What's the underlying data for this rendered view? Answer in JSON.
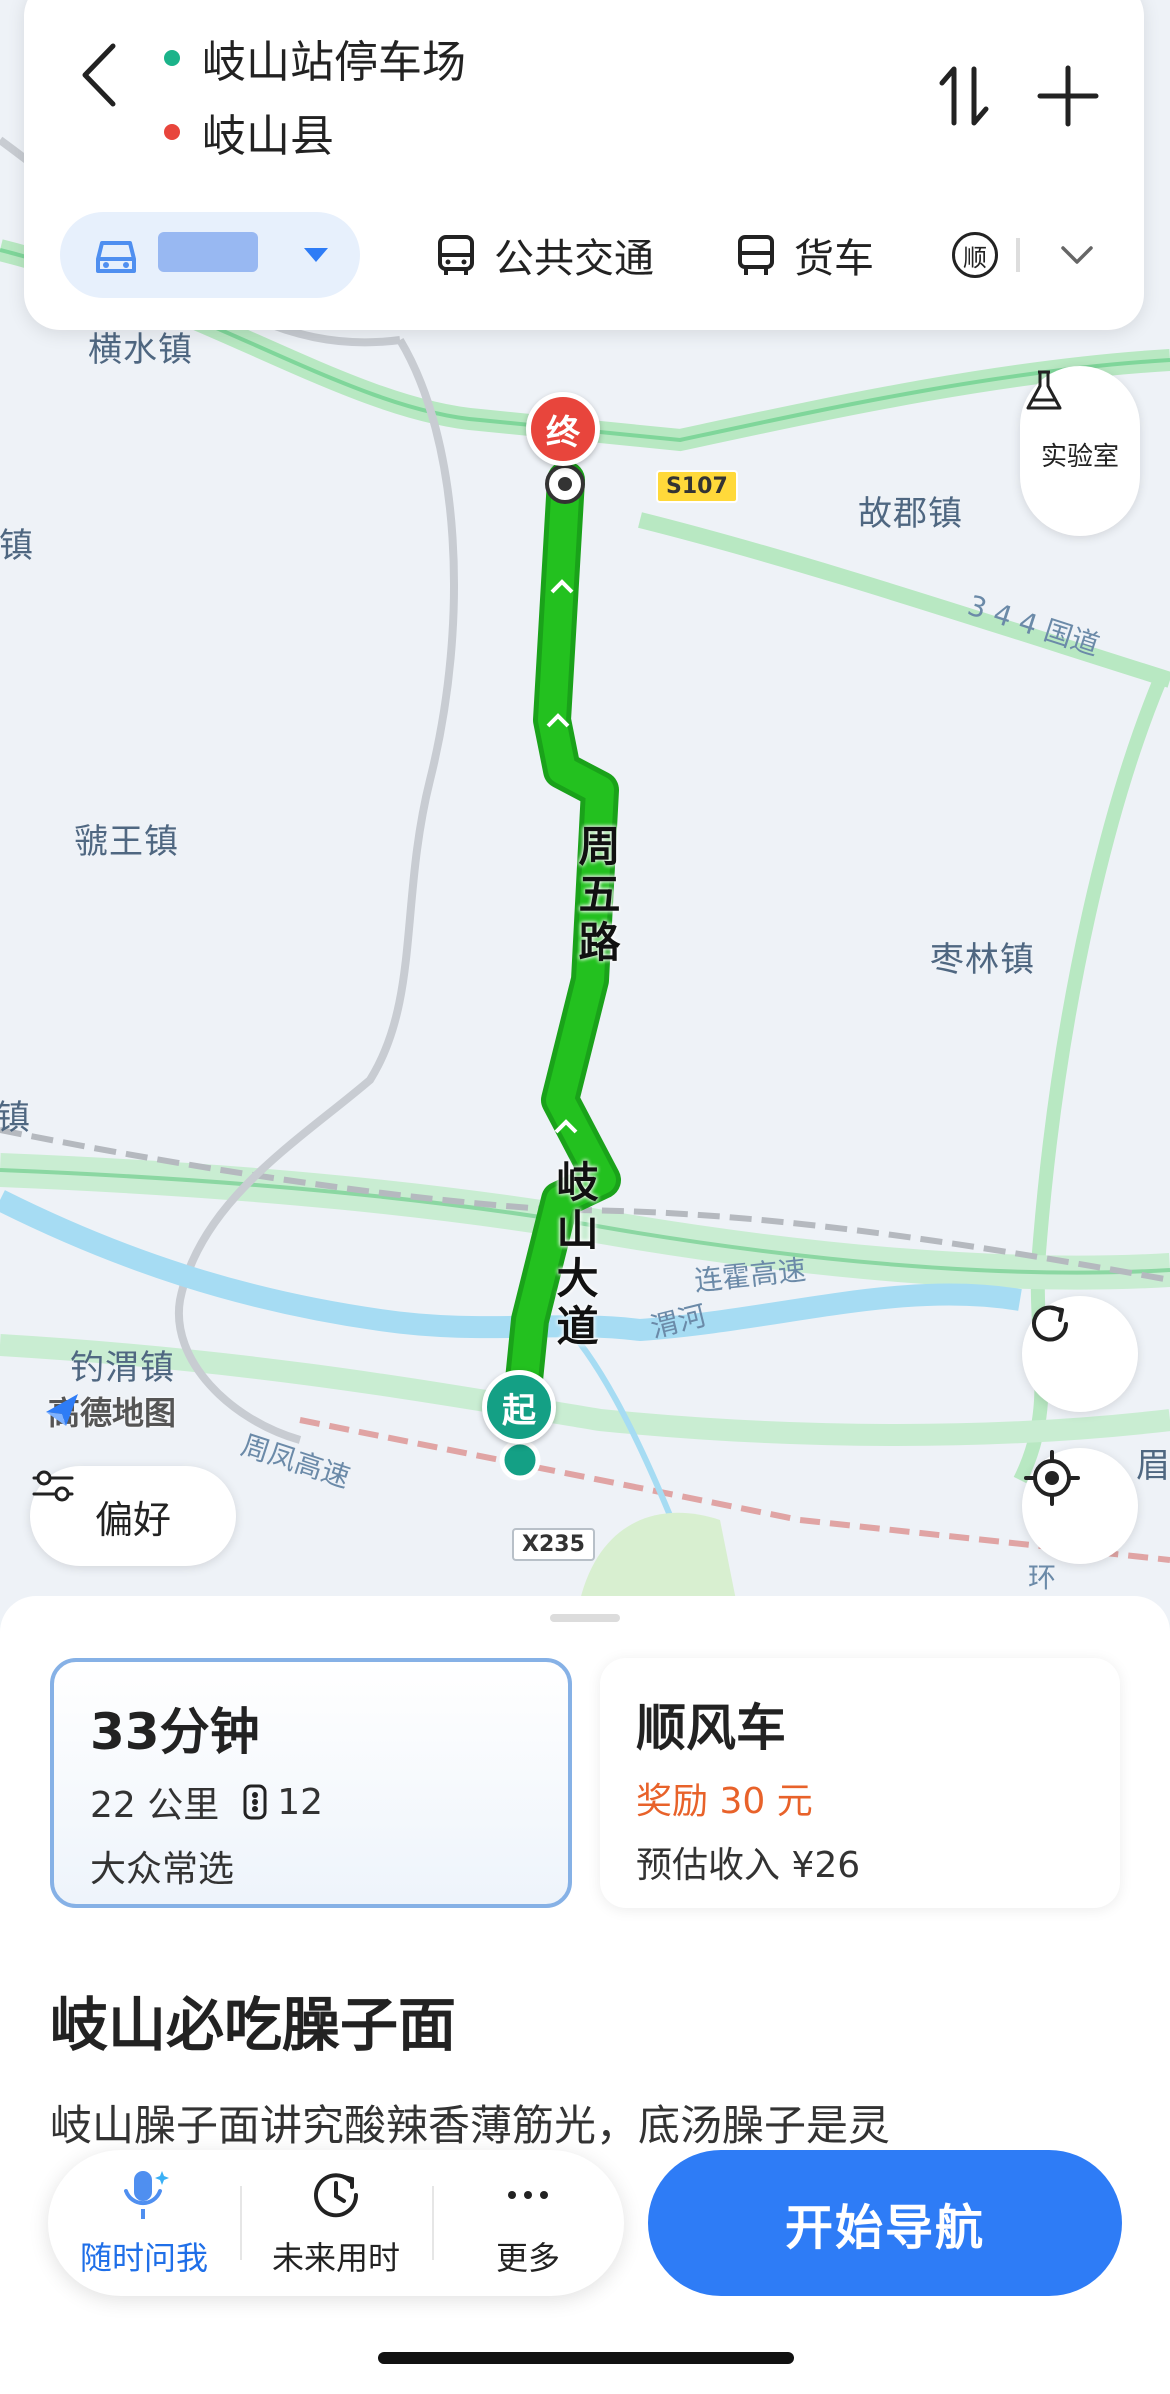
{
  "top": {
    "origin": "岐山站停车场",
    "destination": "岐山县",
    "origin_color": "#1bb38a",
    "destination_color": "#e8453c",
    "modes": [
      {
        "label": "公共交通",
        "icon": "bus-icon"
      },
      {
        "label": "货车",
        "icon": "truck-icon"
      },
      {
        "label": "顺",
        "icon": "carpool-icon"
      }
    ]
  },
  "map": {
    "places": {
      "hengshui": "横水镇",
      "guojun": "故郡镇",
      "guowang": "虢王镇",
      "zaolin": "枣林镇",
      "diaowei": "钓渭镇",
      "left_top": "角镇",
      "left_mid": "镇",
      "right_edge": "眉"
    },
    "roads": {
      "s107": "S107",
      "x235": "X235",
      "g344": "3 4 4 国道",
      "lianhuo": "连霍高速",
      "weihe": "渭河",
      "zhoufeng": "周凤高速",
      "huan": "环"
    },
    "route_names": [
      "周五路",
      "岐山大道"
    ],
    "pin_end": "终",
    "pin_start": "起",
    "logo": "高德地图",
    "lab_label": "实验室",
    "pref_label": "偏好"
  },
  "sheet": {
    "route1": {
      "duration": "33分钟",
      "distance": "22 公里",
      "lights": "12",
      "tag": "大众常选"
    },
    "route2": {
      "title": "顺风车",
      "reward": "奖励 30 元",
      "income": "预估收入 ¥26"
    },
    "article_title": "岐山必吃臊子面",
    "article_body": "岐山臊子面讲究酸辣香薄筋光，底汤臊子是灵"
  },
  "actions": {
    "ask": "随时问我",
    "future": "未来用时",
    "more": "更多",
    "navigate": "开始导航"
  },
  "colors": {
    "route": "#23b81f",
    "accent": "#2e7cf6",
    "reward": "#e8622a"
  }
}
